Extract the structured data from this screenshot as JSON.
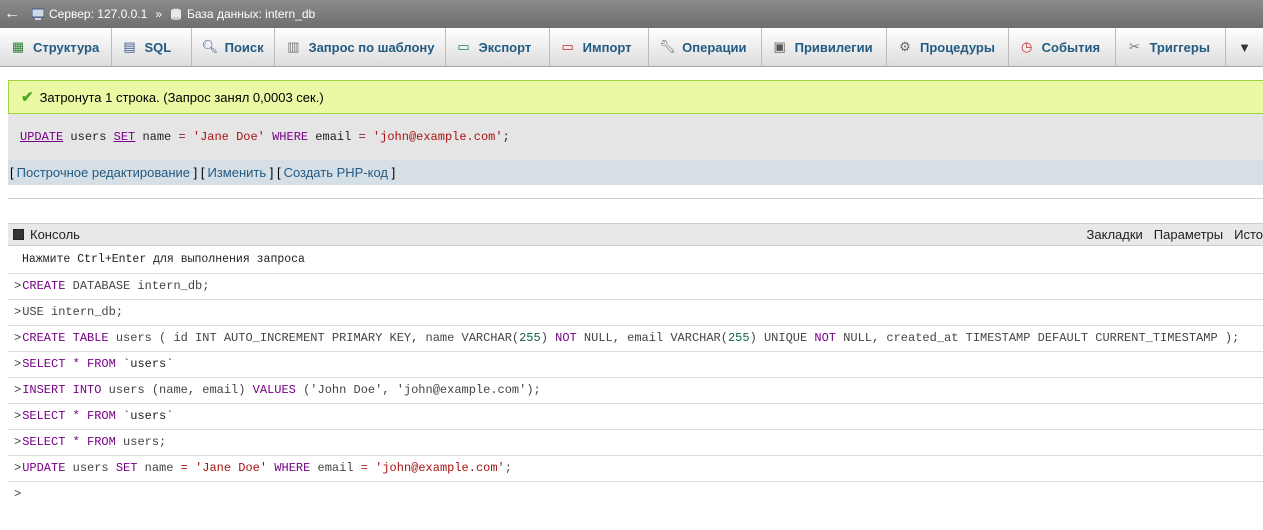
{
  "breadcrumb": {
    "back": "←",
    "server": "Сервер: 127.0.0.1",
    "separator": "»",
    "database": "База данных: intern_db"
  },
  "tabs": [
    {
      "label": "Структура",
      "icon": "structure-icon"
    },
    {
      "label": "SQL",
      "icon": "sql-icon"
    },
    {
      "label": "Поиск",
      "icon": "search-icon"
    },
    {
      "label": "Запрос по шаблону",
      "icon": "query-icon"
    },
    {
      "label": "Экспорт",
      "icon": "export-icon"
    },
    {
      "label": "Импорт",
      "icon": "import-icon"
    },
    {
      "label": "Операции",
      "icon": "wrench-icon"
    },
    {
      "label": "Привилегии",
      "icon": "privileges-icon"
    },
    {
      "label": "Процедуры",
      "icon": "routines-icon"
    },
    {
      "label": "События",
      "icon": "clock-icon"
    },
    {
      "label": "Триггеры",
      "icon": "triggers-icon"
    }
  ],
  "more_tab": "▼",
  "success_message": "Затронута 1 строка. (Запрос занял 0,0003 сек.)",
  "executed_sql": {
    "update": "UPDATE",
    "t1": " users ",
    "set": "SET",
    "t2": " name ",
    "eq1": "=",
    "s1": " 'Jane Doe' ",
    "where": "WHERE",
    "t3": " email ",
    "eq2": "=",
    "s2": " 'john@example.com'",
    "end": ";"
  },
  "links": {
    "open1": "[",
    "inline_edit": "Построчное редактирование",
    "mid1": " ] [",
    "edit": "Изменить",
    "mid2": " ] [",
    "create_php": "Создать PHP-код",
    "close": " ]"
  },
  "console": {
    "title": "Консоль",
    "bookmarks": "Закладки",
    "options": "Параметры",
    "history": "Исто",
    "hint": "Нажмите Ctrl+Enter для выполнения запроса",
    "prompt": ">"
  },
  "queries": {
    "q1": {
      "k1": "CREATE",
      "t1": " DATABASE intern_db;"
    },
    "q2": {
      "t1": "USE intern_db;"
    },
    "q3": {
      "k1": "CREATE",
      "t1": " ",
      "k2": "TABLE",
      "t2": " users ( id INT AUTO_INCREMENT PRIMARY KEY, name VARCHAR(",
      "n1": "255",
      "t3": ") ",
      "k3": "NOT",
      "t4": " NULL, email VARCHAR(",
      "n2": "255",
      "t5": ") UNIQUE ",
      "k4": "NOT",
      "t6": " NULL, created_at TIMESTAMP DEFAULT CURRENT_TIMESTAMP );"
    },
    "q4": {
      "k1": "SELECT",
      "o1": " * ",
      "k2": "FROM",
      "t1": " `users`"
    },
    "q5": {
      "k1": "INSERT",
      "t1": " ",
      "k2": "INTO",
      "t2": " users (name, email) ",
      "k3": "VALUES",
      "t3": " ('John Doe', 'john@example.com');"
    },
    "q6": {
      "k1": "SELECT",
      "o1": " * ",
      "k2": "FROM",
      "t1": " `users`"
    },
    "q7": {
      "k1": "SELECT",
      "o1": " * ",
      "k2": "FROM",
      "t1": " users;"
    },
    "q8": {
      "k1": "UPDATE",
      "t1": " users ",
      "k2": "SET",
      "t2": " name ",
      "o1": "=",
      "s1": " 'Jane Doe' ",
      "k3": "WHERE",
      "t3": " email ",
      "o2": "=",
      "s2": " 'john@example.com'",
      "t4": ";"
    }
  },
  "colors": {
    "keyword": "#770088",
    "string": "#aa1111",
    "number": "#116644",
    "link": "#235a81",
    "success_bg": "#ebf8a4"
  }
}
